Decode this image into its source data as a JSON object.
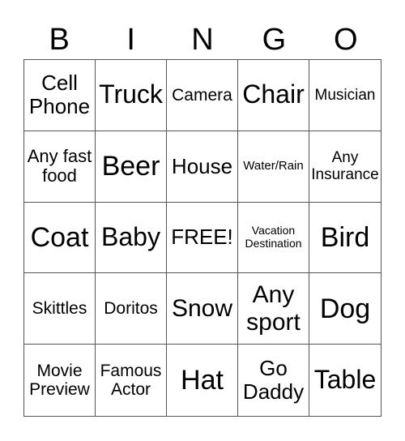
{
  "header": [
    "B",
    "I",
    "N",
    "G",
    "O"
  ],
  "cells": [
    "Cell Phone",
    "Truck",
    "Camera",
    "Chair",
    "Musician",
    "Any fast food",
    "Beer",
    "House",
    "Water/Rain",
    "Any Insurance",
    "Coat",
    "Baby",
    "FREE!",
    "Vacation Destination",
    "Bird",
    "Skittles",
    "Doritos",
    "Snow",
    "Any sport",
    "Dog",
    "Movie Preview",
    "Famous Actor",
    "Hat",
    "Go Daddy",
    "Table"
  ]
}
